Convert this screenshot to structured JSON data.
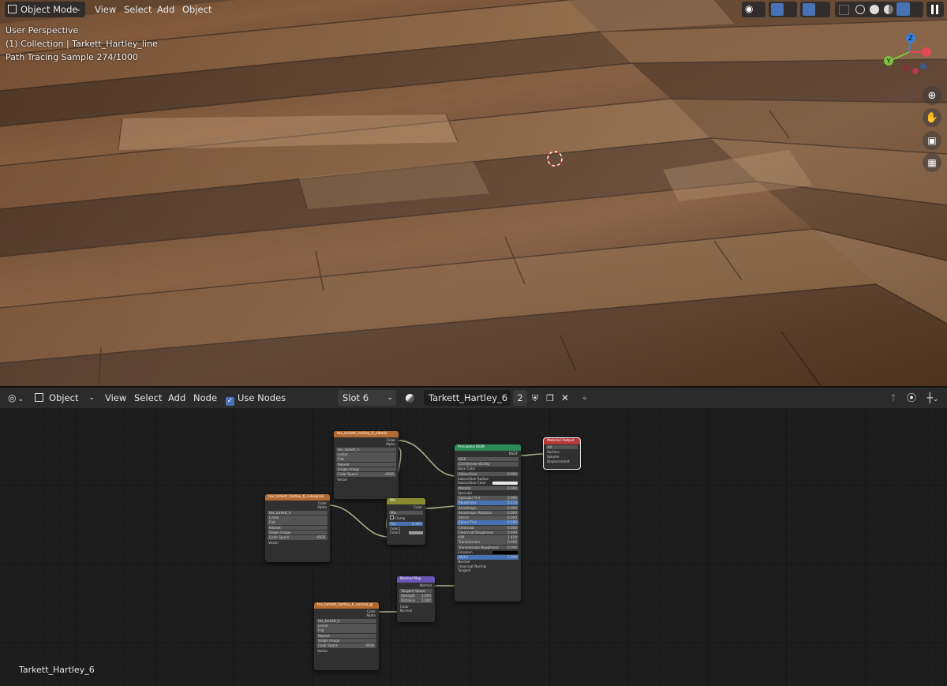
{
  "viewport": {
    "mode_label": "Object Mode",
    "menu": [
      "View",
      "Select",
      "Add",
      "Object"
    ],
    "overlay": [
      "User Perspective",
      "(1) Collection | Tarkett_Hartley_line",
      "Path Tracing Sample 274/1000"
    ],
    "gizmo_axes": {
      "x": "X",
      "y": "Y",
      "z": "Z"
    }
  },
  "node_editor": {
    "editor_type": "Object",
    "menu": [
      "View",
      "Select",
      "Add",
      "Node"
    ],
    "use_nodes_label": "Use Nodes",
    "slot_label": "Slot 6",
    "material_name": "Tarkett_Hartley_6",
    "user_count": "2",
    "footer_material": "Tarkett_Hartley_6"
  },
  "nodes": {
    "tex1": {
      "title": "tex_tarkett_hartley_6_albedo",
      "file": "tex_tarkett_h",
      "outs": [
        "Color",
        "Alpha"
      ],
      "fields": [
        "Linear",
        "Flat",
        "Repeat",
        "Single Image"
      ],
      "cs_label": "Color Space",
      "cs_value": "sRGB",
      "vector": "Vector"
    },
    "tex2": {
      "title": "tex_tarkett_hartley_6_colorgrain",
      "file": "tex_tarkett_h",
      "outs": [
        "Color",
        "Alpha"
      ],
      "fields": [
        "Linear",
        "Flat",
        "Repeat",
        "Single Image"
      ],
      "cs_label": "Color Space",
      "cs_value": "sRGB",
      "vector": "Vector"
    },
    "tex3": {
      "title": "tex_tarkett_hartley_6_normal_gl",
      "file": "tex_tarkett_h",
      "outs": [
        "Color",
        "Alpha"
      ],
      "fields": [
        "Linear",
        "Flat",
        "Repeat",
        "Single Image"
      ],
      "cs_label": "Color Space",
      "cs_value": "sRGB",
      "vector": "Vector"
    },
    "mix": {
      "title": "Mix",
      "out": "Color",
      "blend": "Mix",
      "clamp": "Clamp",
      "fac": "Fac",
      "fac_value": "0.300",
      "c1": "Color1",
      "c2": "Color2"
    },
    "normal": {
      "title": "Normal Map",
      "out": "Normal",
      "space": "Tangent Space",
      "strength": "Strength",
      "strength_value": "1.000",
      "distance": "Distance",
      "distance_value": "1.000",
      "height": "Color",
      "normal": "Normal"
    },
    "bsdf": {
      "title": "Principled BSDF",
      "out": "BSDF",
      "dist": "GGX",
      "sss_method": "Christensen-Burley",
      "rows": [
        {
          "label": "Base Color",
          "value": ""
        },
        {
          "label": "Subsurface",
          "value": "0.000"
        },
        {
          "label": "Subsurface Radius",
          "value": ""
        },
        {
          "label": "Subsurface Color",
          "value": ""
        },
        {
          "label": "Metallic",
          "value": "0.000"
        },
        {
          "label": "Specular",
          "value": ""
        },
        {
          "label": "Specular Tint",
          "value": "0.000"
        },
        {
          "label": "Roughness",
          "value": "0.233"
        },
        {
          "label": "Anisotropic",
          "value": "0.000"
        },
        {
          "label": "Anisotropic Rotation",
          "value": "0.000"
        },
        {
          "label": "Sheen",
          "value": "0.000"
        },
        {
          "label": "Sheen Tint",
          "value": "0.500"
        },
        {
          "label": "Clearcoat",
          "value": "0.000"
        },
        {
          "label": "Clearcoat Roughness",
          "value": "0.030"
        },
        {
          "label": "IOR",
          "value": "1.450"
        },
        {
          "label": "Transmission",
          "value": "0.000"
        },
        {
          "label": "Transmission Roughness",
          "value": "0.000"
        },
        {
          "label": "Emission",
          "value": ""
        },
        {
          "label": "Alpha",
          "value": "1.000"
        },
        {
          "label": "Normal",
          "value": ""
        },
        {
          "label": "Clearcoat Normal",
          "value": ""
        },
        {
          "label": "Tangent",
          "value": ""
        }
      ]
    },
    "output": {
      "title": "Material Output",
      "target": "All",
      "ins": [
        "Surface",
        "Volume",
        "Displacement"
      ]
    }
  },
  "colors": {
    "texture_header": "#b56b30",
    "shader_header": "#2a8a5a",
    "mix_header": "#8a8a30",
    "vector_header": "#6a54b5",
    "output_header": "#b53a3a"
  }
}
